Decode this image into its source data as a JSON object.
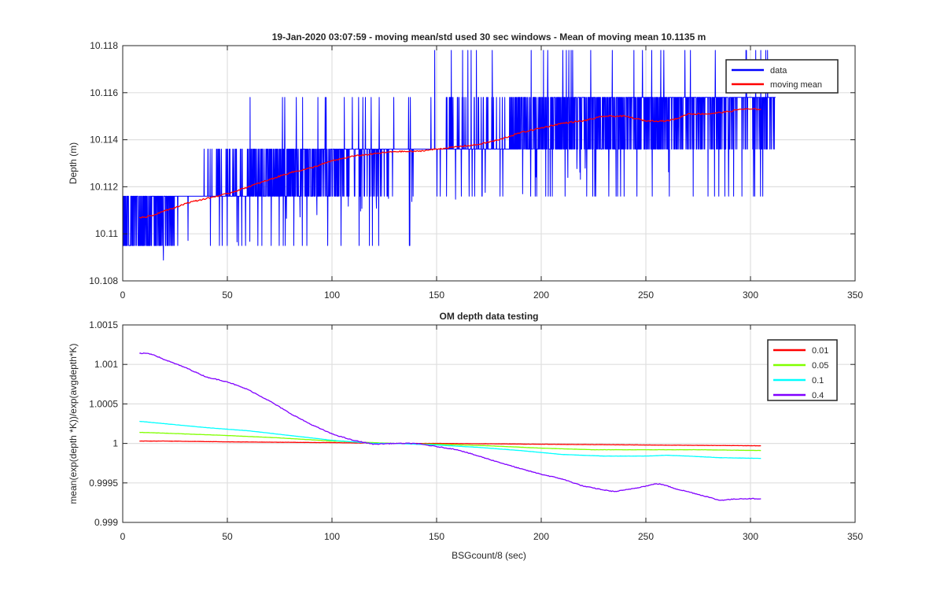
{
  "chart_data": [
    {
      "type": "line",
      "title": "19-Jan-2020 03:07:59 - moving mean/std used 30 sec windows - Mean of moving mean 10.1135 m",
      "xlabel": "",
      "ylabel": "Depth (m)",
      "xlim": [
        0,
        350
      ],
      "ylim": [
        10.108,
        10.118
      ],
      "xticks": [
        0,
        50,
        100,
        150,
        200,
        250,
        300,
        350
      ],
      "xtick_labels": [
        "0",
        "50",
        "100",
        "150",
        "200",
        "250",
        "300",
        "350"
      ],
      "yticks": [
        10.108,
        10.11,
        10.112,
        10.114,
        10.116,
        10.118
      ],
      "ytick_labels": [
        "10.108",
        "10.11",
        "10.112",
        "10.114",
        "10.116",
        "10.118"
      ],
      "grid": true,
      "legend_position": "top-right",
      "series": [
        {
          "name": "data",
          "color": "#0000ff",
          "style": "noisy-quantized",
          "x_range": [
            0,
            312
          ],
          "levels": [
            10.1095,
            10.1116,
            10.1136,
            10.1158,
            10.1178
          ],
          "mean_profile_x": [
            0,
            10,
            20,
            30,
            40,
            50,
            60,
            70,
            75,
            80,
            90,
            100,
            120,
            140,
            160,
            180,
            200,
            220,
            225,
            240,
            260,
            280,
            300,
            312
          ],
          "mean_profile_y": [
            10.1105,
            10.1107,
            10.111,
            10.1115,
            10.1117,
            10.1119,
            10.1122,
            10.1124,
            10.1125,
            10.1126,
            10.1128,
            10.113,
            10.1134,
            10.1136,
            10.1138,
            10.114,
            10.1145,
            10.1148,
            10.115,
            10.115,
            10.1149,
            10.1152,
            10.1153,
            10.1153
          ]
        },
        {
          "name": "moving mean",
          "color": "#ff0000",
          "x": [
            8,
            10,
            15,
            20,
            25,
            30,
            40,
            50,
            60,
            70,
            80,
            90,
            100,
            110,
            120,
            130,
            140,
            150,
            160,
            170,
            180,
            190,
            200,
            210,
            220,
            230,
            240,
            245,
            250,
            255,
            260,
            265,
            270,
            280,
            290,
            295,
            300,
            305
          ],
          "y": [
            10.1107,
            10.1107,
            10.1108,
            10.111,
            10.1111,
            10.1113,
            10.1115,
            10.1117,
            10.112,
            10.1123,
            10.1126,
            10.1128,
            10.1131,
            10.1133,
            10.1134,
            10.1135,
            10.1135,
            10.1136,
            10.1137,
            10.1138,
            10.114,
            10.1143,
            10.1145,
            10.1147,
            10.1148,
            10.115,
            10.115,
            10.1149,
            10.1148,
            10.1148,
            10.1148,
            10.1149,
            10.1151,
            10.1151,
            10.1152,
            10.1153,
            10.1153,
            10.1153
          ]
        }
      ]
    },
    {
      "type": "line",
      "title": "OM depth data testing",
      "xlabel": "BSGcount/8 (sec)",
      "ylabel": "mean(exp(depth *K))/exp(avgdepth*K)",
      "xlim": [
        0,
        350
      ],
      "ylim": [
        0.999,
        1.0015
      ],
      "xticks": [
        0,
        50,
        100,
        150,
        200,
        250,
        300,
        350
      ],
      "xtick_labels": [
        "0",
        "50",
        "100",
        "150",
        "200",
        "250",
        "300",
        "350"
      ],
      "yticks": [
        0.999,
        0.9995,
        1,
        1.0005,
        1.001,
        1.0015
      ],
      "ytick_labels": [
        "0.999",
        "0.9995",
        "1",
        "1.0005",
        "1.001",
        "1.0015"
      ],
      "grid": true,
      "legend_position": "top-right",
      "series": [
        {
          "name": "0.01",
          "color": "#ff0000",
          "x": [
            8,
            20,
            50,
            100,
            130,
            150,
            200,
            250,
            305
          ],
          "y": [
            1.00003,
            1.00003,
            1.00002,
            1.00001,
            1.0,
            1.0,
            0.99999,
            0.99998,
            0.99997
          ]
        },
        {
          "name": "0.05",
          "color": "#80ff00",
          "x": [
            8,
            20,
            50,
            75,
            100,
            130,
            150,
            175,
            200,
            225,
            250,
            275,
            305
          ],
          "y": [
            1.00014,
            1.00013,
            1.0001,
            1.00007,
            1.00003,
            1.0,
            0.99999,
            0.99997,
            0.99994,
            0.99992,
            0.99992,
            0.99992,
            0.99991
          ]
        },
        {
          "name": "0.1",
          "color": "#00ffff",
          "x": [
            8,
            20,
            40,
            60,
            80,
            100,
            120,
            130,
            150,
            170,
            190,
            210,
            230,
            250,
            260,
            270,
            285,
            305
          ],
          "y": [
            1.00028,
            1.00025,
            1.0002,
            1.00016,
            1.0001,
            1.00004,
            1.0,
            1.0,
            0.99998,
            0.99995,
            0.99991,
            0.99986,
            0.99984,
            0.99984,
            0.99985,
            0.99984,
            0.99982,
            0.99981
          ]
        },
        {
          "name": "0.4",
          "color": "#8000ff",
          "x": [
            8,
            12,
            15,
            20,
            30,
            40,
            50,
            60,
            70,
            80,
            90,
            100,
            110,
            120,
            130,
            140,
            150,
            160,
            170,
            180,
            190,
            200,
            210,
            220,
            230,
            235,
            240,
            250,
            255,
            258,
            265,
            270,
            280,
            285,
            295,
            305
          ],
          "y": [
            1.00114,
            1.00114,
            1.00112,
            1.00106,
            1.00096,
            1.00084,
            1.00078,
            1.00068,
            1.00054,
            1.00038,
            1.00024,
            1.00012,
            1.00004,
            0.99999,
            1.0,
            1.0,
            0.99996,
            0.99992,
            0.99984,
            0.99976,
            0.99968,
            0.99961,
            0.99955,
            0.99946,
            0.99941,
            0.99939,
            0.99941,
            0.99946,
            0.99949,
            0.99948,
            0.99942,
            0.99939,
            0.99932,
            0.99928,
            0.9993,
            0.9993
          ]
        }
      ]
    }
  ]
}
